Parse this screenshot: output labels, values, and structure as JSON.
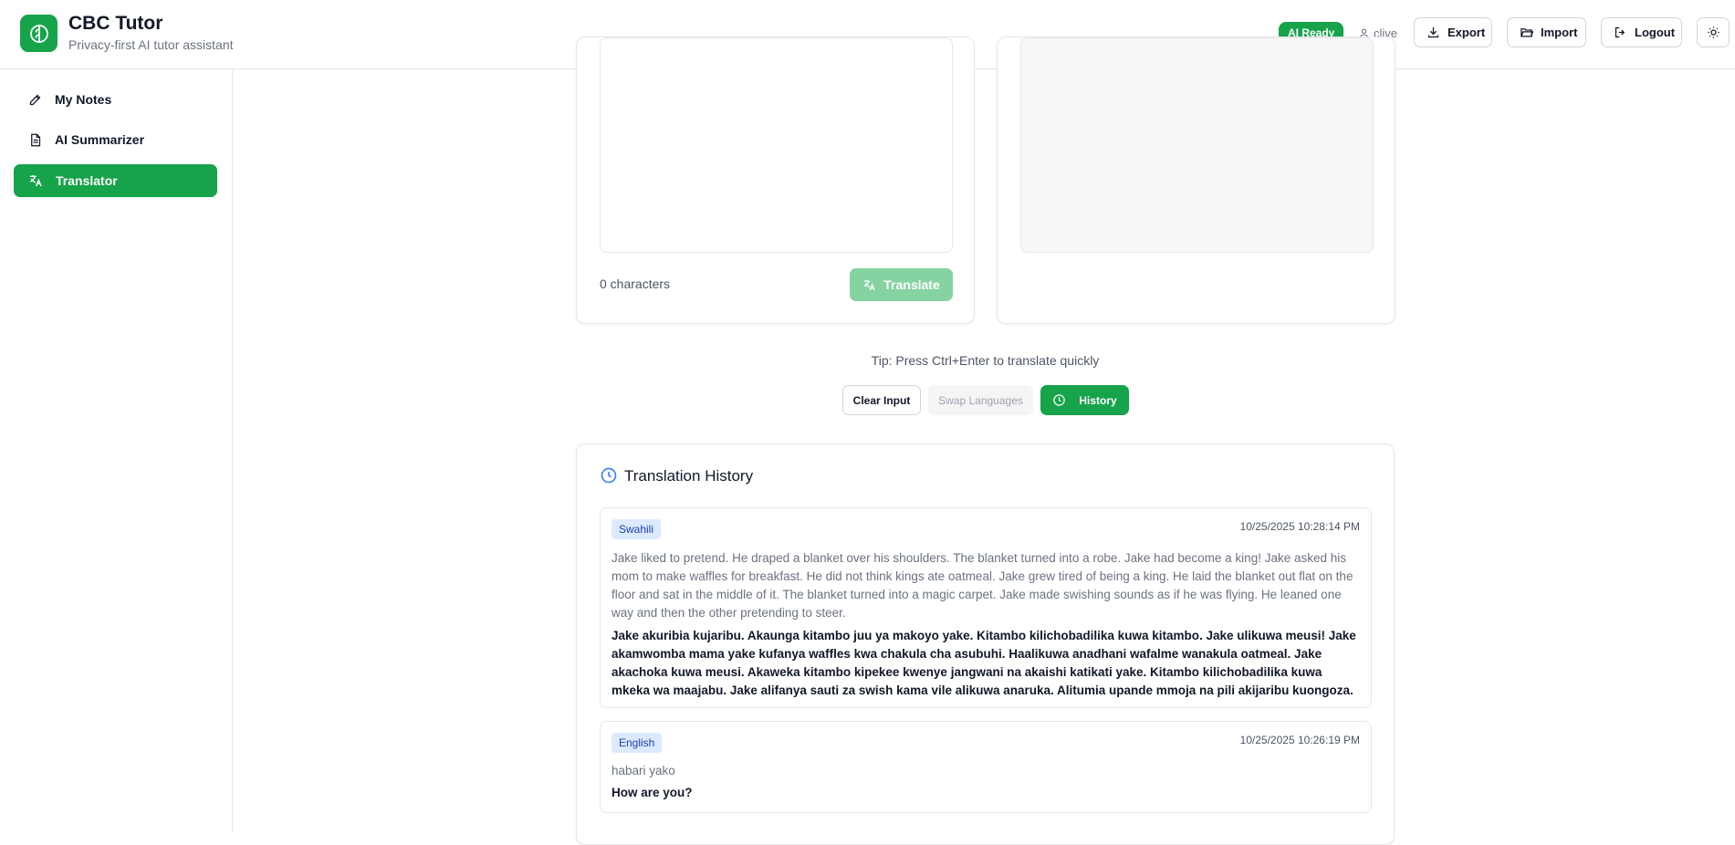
{
  "app": {
    "title": "CBC Tutor",
    "subtitle": "Privacy-first AI tutor assistant"
  },
  "header": {
    "status_badge": "AI Ready",
    "user": "clive",
    "export_label": "Export",
    "import_label": "Import",
    "logout_label": "Logout"
  },
  "sidebar": {
    "items": [
      {
        "label": "My Notes",
        "icon": "pencil-icon",
        "active": false
      },
      {
        "label": "AI Summarizer",
        "icon": "document-icon",
        "active": false
      },
      {
        "label": "Translator",
        "icon": "translate-icon",
        "active": true
      }
    ]
  },
  "translator": {
    "char_count": "0 characters",
    "translate_label": "Translate",
    "tip": "Tip: Press Ctrl+Enter to translate quickly",
    "clear_label": "Clear Input",
    "swap_label": "Swap Languages",
    "history_label": "History"
  },
  "history": {
    "title": "Translation History",
    "entries": [
      {
        "language": "Swahili",
        "timestamp": "10/25/2025 10:28:14 PM",
        "source": "Jake liked to pretend. He draped a blanket over his shoulders. The blanket turned into a robe. Jake had become a king! Jake asked his mom to make waffles for breakfast. He did not think kings ate oatmeal. Jake grew tired of being a king. He laid the blanket out flat on the floor and sat in the middle of it. The blanket turned into a magic carpet. Jake made swishing sounds as if he was flying. He leaned one way and then the other pretending to steer.",
        "translation": "Jake akuribia kujaribu. Akaunga kitambo juu ya makoyo yake. Kitambo kilichobadilika kuwa kitambo. Jake ulikuwa meusi! Jake akamwomba mama yake kufanya waffles kwa chakula cha asubuhi. Haalikuwa anadhani wafalme wanakula oatmeal. Jake akachoka kuwa meusi. Akaweka kitambo kipekee kwenye jangwani na akaishi katikati yake. Kitambo kilichobadilika kuwa mkeka wa maajabu. Jake alifanya sauti za swish kama vile alikuwa anaruka. Alitumia upande mmoja na pili akijaribu kuongoza."
      },
      {
        "language": "English",
        "timestamp": "10/25/2025 10:26:19 PM",
        "source": "habari yako",
        "translation": "How are you?"
      }
    ]
  },
  "colors": {
    "accent": "#16a34a",
    "accent_disabled": "#86d3a2",
    "badge_bg": "#dbeafe",
    "history_icon": "#3b82f6"
  }
}
